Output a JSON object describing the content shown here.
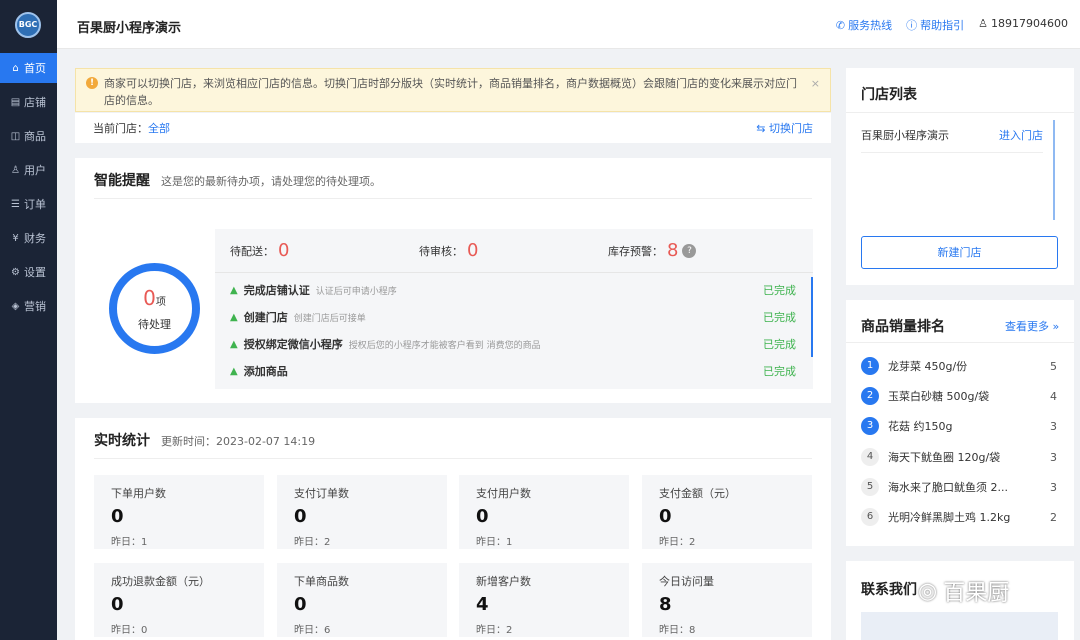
{
  "sidebar": {
    "logo": "BGC",
    "items": [
      {
        "icon": "⌂",
        "label": "首页"
      },
      {
        "icon": "▤",
        "label": "店铺"
      },
      {
        "icon": "◫",
        "label": "商品"
      },
      {
        "icon": "♙",
        "label": "用户"
      },
      {
        "icon": "☰",
        "label": "订单"
      },
      {
        "icon": "¥",
        "label": "财务"
      },
      {
        "icon": "⚙",
        "label": "设置"
      },
      {
        "icon": "◈",
        "label": "营销"
      }
    ]
  },
  "header": {
    "title": "百果厨小程序演示",
    "hotline": "服务热线",
    "help": "帮助指引",
    "user": "18917904600"
  },
  "notice": {
    "text": "商家可以切换门店，来浏览相应门店的信息。切换门店时部分版块（实时统计，商品销量排名，商户数据概览）会跟随门店的变化来展示对应门店的信息。",
    "close": "×"
  },
  "current_store": {
    "label": "当前门店：",
    "value": "全部",
    "switch": "切换门店"
  },
  "reminder": {
    "title": "智能提醒",
    "subtitle": "这是您的最新待办项，请处理您的待处理项。",
    "pending": "0",
    "unit": "项",
    "pending_label": "待处理",
    "delivery_label": "待配送：",
    "delivery": "0",
    "review_label": "待审核：",
    "review": "0",
    "stock_label": "库存预警：",
    "stock": "8",
    "items": [
      {
        "title": "完成店铺认证",
        "desc": "认证后可申请小程序",
        "status": "已完成"
      },
      {
        "title": "创建门店",
        "desc": "创建门店后可接单",
        "status": "已完成"
      },
      {
        "title": "授权绑定微信小程序",
        "desc": "授权后您的小程序才能被客户看到 消费您的商品",
        "status": "已完成"
      },
      {
        "title": "添加商品",
        "desc": "",
        "status": "已完成"
      }
    ]
  },
  "stats": {
    "title": "实时统计",
    "update_label": "更新时间：",
    "update_time": "2023-02-07 14:19",
    "cards": [
      {
        "label": "下单用户数",
        "value": "0",
        "prev": "昨日：1"
      },
      {
        "label": "支付订单数",
        "value": "0",
        "prev": "昨日：2"
      },
      {
        "label": "支付用户数",
        "value": "0",
        "prev": "昨日：1"
      },
      {
        "label": "支付金额（元）",
        "value": "0",
        "prev": "昨日：2"
      },
      {
        "label": "成功退款金额（元）",
        "value": "0",
        "prev": "昨日：0"
      },
      {
        "label": "下单商品数",
        "value": "0",
        "prev": "昨日：6"
      },
      {
        "label": "新增客户数",
        "value": "4",
        "prev": "昨日：2"
      },
      {
        "label": "今日访问量",
        "value": "8",
        "prev": "昨日：8"
      }
    ]
  },
  "store_list": {
    "title": "门店列表",
    "items": [
      {
        "name": "百果厨小程序演示",
        "action": "进入门店"
      }
    ],
    "new_button": "新建门店"
  },
  "ranking": {
    "title": "商品销量排名",
    "more": "查看更多 »",
    "items": [
      {
        "no": "1",
        "name": "龙芽菜 450g/份",
        "count": "5"
      },
      {
        "no": "2",
        "name": "玉菜白砂糖 500g/袋",
        "count": "4"
      },
      {
        "no": "3",
        "name": "花菇 约150g",
        "count": "3"
      },
      {
        "no": "4",
        "name": "海天下鱿鱼圈 120g/袋",
        "count": "3"
      },
      {
        "no": "5",
        "name": "海水来了脆口鱿鱼须 2...",
        "count": "3"
      },
      {
        "no": "6",
        "name": "光明冷鲜黑脚土鸡 1.2kg",
        "count": "2"
      }
    ]
  },
  "contact": {
    "title": "联系我们"
  },
  "watermark": "百果厨"
}
